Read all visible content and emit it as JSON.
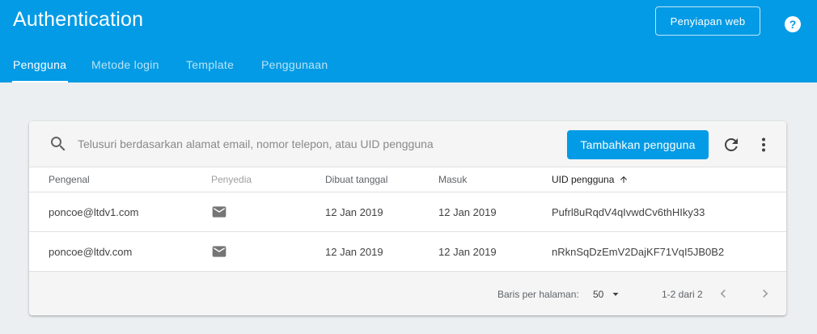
{
  "header": {
    "title": "Authentication",
    "web_setup_label": "Penyiapan web",
    "help_icon": "?"
  },
  "tabs": [
    {
      "label": "Pengguna",
      "active": true
    },
    {
      "label": "Metode login",
      "active": false
    },
    {
      "label": "Template",
      "active": false
    },
    {
      "label": "Penggunaan",
      "active": false
    }
  ],
  "toolbar": {
    "search_placeholder": "Telusuri berdasarkan alamat email, nomor telepon, atau UID pengguna",
    "search_value": "",
    "add_user_label": "Tambahkan pengguna",
    "icons": [
      "search-icon",
      "refresh-icon",
      "more-vert-icon"
    ]
  },
  "table": {
    "columns": [
      "Pengenal",
      "Penyedia",
      "Dibuat tanggal",
      "Masuk",
      "UID pengguna"
    ],
    "sort_column": "UID pengguna",
    "sort_direction": "ascending",
    "rows": [
      {
        "identifier": "poncoe@ltdv1.com",
        "provider": "email-icon",
        "created": "12 Jan 2019",
        "signed_in": "12 Jan 2019",
        "uid": "Pufrl8uRqdV4qIvwdCv6thHIky33"
      },
      {
        "identifier": "poncoe@ltdv.com",
        "provider": "email-icon",
        "created": "12 Jan 2019",
        "signed_in": "12 Jan 2019",
        "uid": "nRknSqDzEmV2DajKF71VqI5JB0B2"
      }
    ]
  },
  "pagination": {
    "rows_per_page_label": "Baris per halaman:",
    "rows_per_page_value": "50",
    "range_text": "1-2 dari 2"
  },
  "colors": {
    "header_bg": "#039be5",
    "page_bg": "#eceff1",
    "primary_button": "#039be5"
  }
}
